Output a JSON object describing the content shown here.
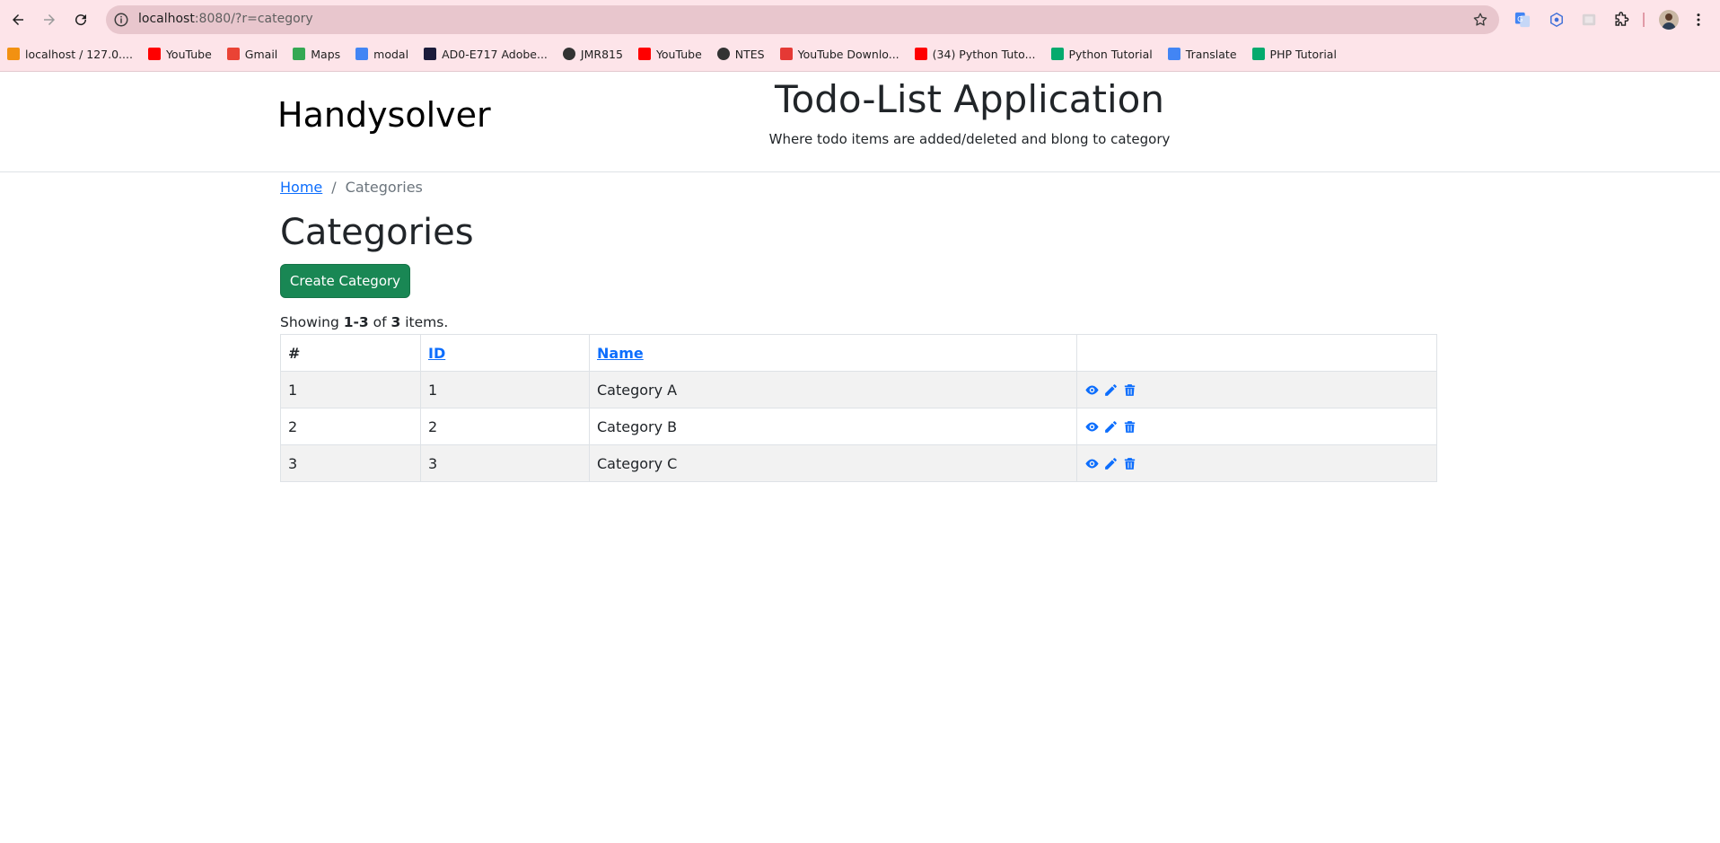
{
  "browser": {
    "url_host": "localhost",
    "url_rest": ":8080/?r=category",
    "bookmarks": [
      {
        "label": "localhost / 127.0....",
        "icon": "phpmyadmin-icon",
        "color": "#f29111"
      },
      {
        "label": "YouTube",
        "icon": "youtube-icon",
        "color": "#ff0000"
      },
      {
        "label": "Gmail",
        "icon": "gmail-icon",
        "color": "#ea4335"
      },
      {
        "label": "Maps",
        "icon": "maps-icon",
        "color": "#34a853"
      },
      {
        "label": "modal",
        "icon": "modal-icon",
        "color": "#4285f4"
      },
      {
        "label": "AD0-E717 Adobe...",
        "icon": "adobe-icon",
        "color": "#1b1b3a"
      },
      {
        "label": "JMR815",
        "icon": "globe-icon",
        "color": "#333333"
      },
      {
        "label": "YouTube",
        "icon": "youtube-icon",
        "color": "#ff0000"
      },
      {
        "label": "NTES",
        "icon": "globe-icon",
        "color": "#333333"
      },
      {
        "label": "YouTube Downlo...",
        "icon": "download-icon",
        "color": "#e53935"
      },
      {
        "label": "(34) Python Tuto...",
        "icon": "youtube-icon",
        "color": "#ff0000"
      },
      {
        "label": "Python Tutorial",
        "icon": "w3schools-icon",
        "color": "#04aa6d"
      },
      {
        "label": "Translate",
        "icon": "translate-icon",
        "color": "#4285f4"
      },
      {
        "label": "PHP Tutorial",
        "icon": "w3schools-icon",
        "color": "#04aa6d"
      }
    ]
  },
  "header": {
    "brand": "Handysolver",
    "title": "Todo-List Application",
    "subtitle": "Where todo items are added/deleted and blong to category"
  },
  "breadcrumb": {
    "home": "Home",
    "separator": "/",
    "current": "Categories"
  },
  "page": {
    "title": "Categories",
    "create_button": "Create Category",
    "summary_prefix": "Showing ",
    "summary_range": "1-3",
    "summary_mid": " of ",
    "summary_total": "3",
    "summary_suffix": " items."
  },
  "table": {
    "headers": {
      "num": "#",
      "id": "ID",
      "name": "Name"
    },
    "rows": [
      {
        "num": "1",
        "id": "1",
        "name": "Category A"
      },
      {
        "num": "2",
        "id": "2",
        "name": "Category B"
      },
      {
        "num": "3",
        "id": "3",
        "name": "Category C"
      }
    ]
  },
  "colors": {
    "primary": "#0d6efd",
    "success": "#198754",
    "chrome_bg": "#fde4e9"
  }
}
